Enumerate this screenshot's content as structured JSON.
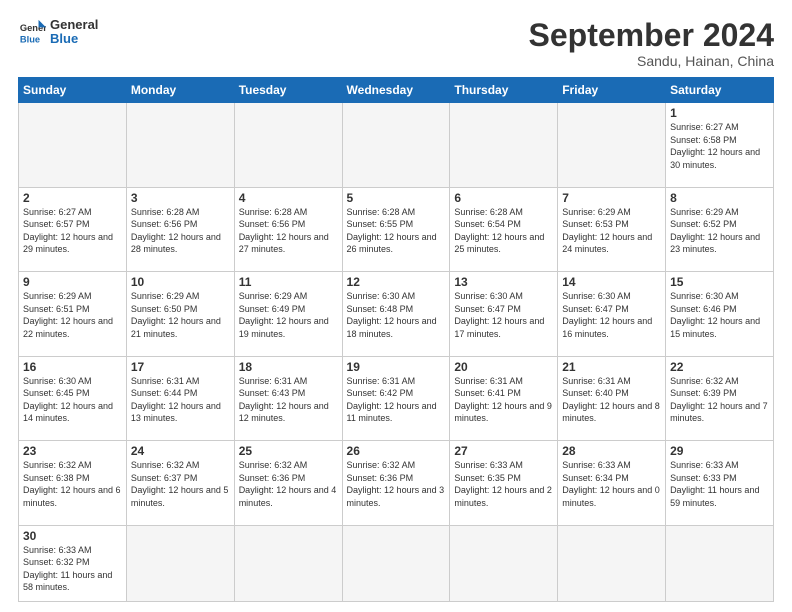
{
  "logo": {
    "line1": "General",
    "line2": "Blue"
  },
  "header": {
    "month": "September 2024",
    "location": "Sandu, Hainan, China"
  },
  "weekdays": [
    "Sunday",
    "Monday",
    "Tuesday",
    "Wednesday",
    "Thursday",
    "Friday",
    "Saturday"
  ],
  "days": [
    {
      "num": "",
      "info": ""
    },
    {
      "num": "",
      "info": ""
    },
    {
      "num": "",
      "info": ""
    },
    {
      "num": "",
      "info": ""
    },
    {
      "num": "",
      "info": ""
    },
    {
      "num": "",
      "info": ""
    },
    {
      "num": "1",
      "sunrise": "6:27 AM",
      "sunset": "6:58 PM",
      "daylight": "12 hours and 30 minutes."
    },
    {
      "num": "2",
      "sunrise": "6:27 AM",
      "sunset": "6:57 PM",
      "daylight": "12 hours and 29 minutes."
    },
    {
      "num": "3",
      "sunrise": "6:28 AM",
      "sunset": "6:56 PM",
      "daylight": "12 hours and 28 minutes."
    },
    {
      "num": "4",
      "sunrise": "6:28 AM",
      "sunset": "6:56 PM",
      "daylight": "12 hours and 27 minutes."
    },
    {
      "num": "5",
      "sunrise": "6:28 AM",
      "sunset": "6:55 PM",
      "daylight": "12 hours and 26 minutes."
    },
    {
      "num": "6",
      "sunrise": "6:28 AM",
      "sunset": "6:54 PM",
      "daylight": "12 hours and 25 minutes."
    },
    {
      "num": "7",
      "sunrise": "6:29 AM",
      "sunset": "6:53 PM",
      "daylight": "12 hours and 24 minutes."
    },
    {
      "num": "8",
      "sunrise": "6:29 AM",
      "sunset": "6:52 PM",
      "daylight": "12 hours and 23 minutes."
    },
    {
      "num": "9",
      "sunrise": "6:29 AM",
      "sunset": "6:51 PM",
      "daylight": "12 hours and 22 minutes."
    },
    {
      "num": "10",
      "sunrise": "6:29 AM",
      "sunset": "6:50 PM",
      "daylight": "12 hours and 21 minutes."
    },
    {
      "num": "11",
      "sunrise": "6:29 AM",
      "sunset": "6:49 PM",
      "daylight": "12 hours and 19 minutes."
    },
    {
      "num": "12",
      "sunrise": "6:30 AM",
      "sunset": "6:48 PM",
      "daylight": "12 hours and 18 minutes."
    },
    {
      "num": "13",
      "sunrise": "6:30 AM",
      "sunset": "6:47 PM",
      "daylight": "12 hours and 17 minutes."
    },
    {
      "num": "14",
      "sunrise": "6:30 AM",
      "sunset": "6:47 PM",
      "daylight": "12 hours and 16 minutes."
    },
    {
      "num": "15",
      "sunrise": "6:30 AM",
      "sunset": "6:46 PM",
      "daylight": "12 hours and 15 minutes."
    },
    {
      "num": "16",
      "sunrise": "6:30 AM",
      "sunset": "6:45 PM",
      "daylight": "12 hours and 14 minutes."
    },
    {
      "num": "17",
      "sunrise": "6:31 AM",
      "sunset": "6:44 PM",
      "daylight": "12 hours and 13 minutes."
    },
    {
      "num": "18",
      "sunrise": "6:31 AM",
      "sunset": "6:43 PM",
      "daylight": "12 hours and 12 minutes."
    },
    {
      "num": "19",
      "sunrise": "6:31 AM",
      "sunset": "6:42 PM",
      "daylight": "12 hours and 11 minutes."
    },
    {
      "num": "20",
      "sunrise": "6:31 AM",
      "sunset": "6:41 PM",
      "daylight": "12 hours and 9 minutes."
    },
    {
      "num": "21",
      "sunrise": "6:31 AM",
      "sunset": "6:40 PM",
      "daylight": "12 hours and 8 minutes."
    },
    {
      "num": "22",
      "sunrise": "6:32 AM",
      "sunset": "6:39 PM",
      "daylight": "12 hours and 7 minutes."
    },
    {
      "num": "23",
      "sunrise": "6:32 AM",
      "sunset": "6:38 PM",
      "daylight": "12 hours and 6 minutes."
    },
    {
      "num": "24",
      "sunrise": "6:32 AM",
      "sunset": "6:37 PM",
      "daylight": "12 hours and 5 minutes."
    },
    {
      "num": "25",
      "sunrise": "6:32 AM",
      "sunset": "6:36 PM",
      "daylight": "12 hours and 4 minutes."
    },
    {
      "num": "26",
      "sunrise": "6:32 AM",
      "sunset": "6:36 PM",
      "daylight": "12 hours and 3 minutes."
    },
    {
      "num": "27",
      "sunrise": "6:33 AM",
      "sunset": "6:35 PM",
      "daylight": "12 hours and 2 minutes."
    },
    {
      "num": "28",
      "sunrise": "6:33 AM",
      "sunset": "6:34 PM",
      "daylight": "12 hours and 0 minutes."
    },
    {
      "num": "29",
      "sunrise": "6:33 AM",
      "sunset": "6:33 PM",
      "daylight": "11 hours and 59 minutes."
    },
    {
      "num": "30",
      "sunrise": "6:33 AM",
      "sunset": "6:32 PM",
      "daylight": "11 hours and 58 minutes."
    }
  ],
  "labels": {
    "sunrise": "Sunrise:",
    "sunset": "Sunset:",
    "daylight": "Daylight:"
  }
}
